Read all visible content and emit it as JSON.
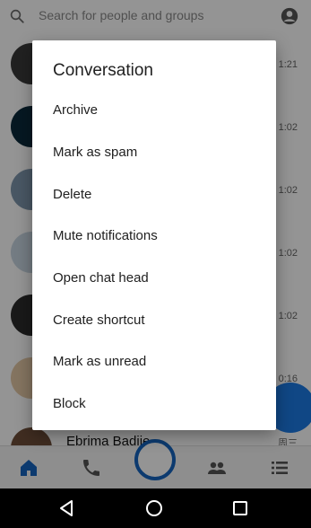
{
  "search": {
    "placeholder": "Search for people and groups"
  },
  "conversations": [
    {
      "time": "1:21",
      "avatar_color": "#3a3a3a"
    },
    {
      "time": "1:02",
      "avatar_color": "#0b2a3c"
    },
    {
      "time": "1:02",
      "avatar_color": "#7f97ad"
    },
    {
      "time": "1:02",
      "avatar_color": "#c9d6e2"
    },
    {
      "time": "1:02",
      "avatar_color": "#2b2b2b"
    },
    {
      "time": "0:16",
      "avatar_color": "#e3c8a6"
    },
    {
      "name": "Ebrima Badjie",
      "time": "周三",
      "avatar_color": "#6f4f3a"
    }
  ],
  "dialog": {
    "title": "Conversation",
    "items": [
      {
        "label": "Archive"
      },
      {
        "label": "Mark as spam"
      },
      {
        "label": "Delete"
      },
      {
        "label": "Mute notifications"
      },
      {
        "label": "Open chat head"
      },
      {
        "label": "Create shortcut"
      },
      {
        "label": "Mark as unread"
      },
      {
        "label": "Block"
      }
    ]
  },
  "colors": {
    "accent": "#1d7be6",
    "scrim": "rgba(0,0,0,0.42)"
  },
  "icons": {
    "search": "search-icon",
    "profile": "profile-icon",
    "home": "home-icon",
    "call": "phone-icon",
    "camera": "camera-ring-icon",
    "people": "people-icon",
    "list": "list-icon",
    "back": "back-triangle-icon",
    "home_sys": "home-circle-icon",
    "recents": "recents-square-icon"
  }
}
